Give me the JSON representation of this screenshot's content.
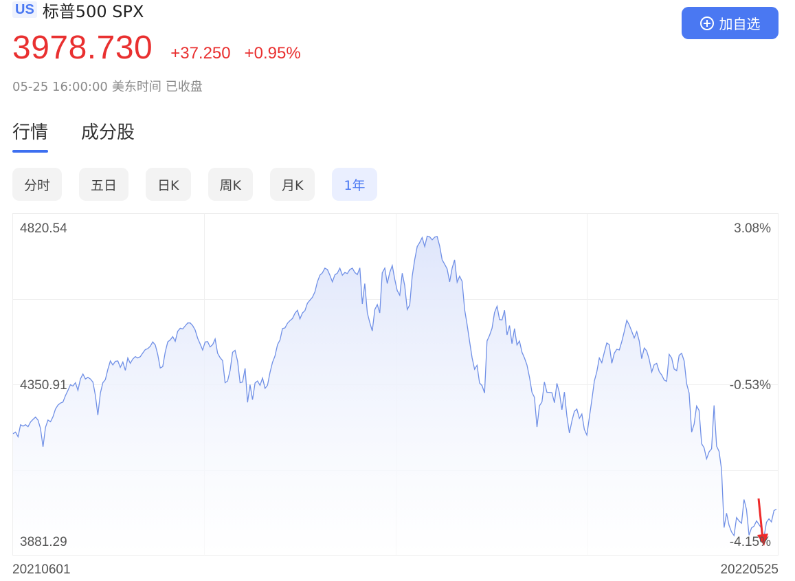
{
  "header": {
    "market": "US",
    "name": "标普500 SPX"
  },
  "quote": {
    "price": "3978.730",
    "change": "+37.250",
    "change_pct": "+0.95%",
    "date_time": "05-25 16:00:00",
    "timezone": "美东时间",
    "status": "已收盘"
  },
  "watchlist_button": {
    "label": "加自选",
    "icon": "plus-circle-icon"
  },
  "tabs": [
    {
      "label": "行情",
      "active": true
    },
    {
      "label": "成分股",
      "active": false
    }
  ],
  "periods": [
    {
      "label": "分时",
      "active": false
    },
    {
      "label": "五日",
      "active": false
    },
    {
      "label": "日K",
      "active": false
    },
    {
      "label": "周K",
      "active": false
    },
    {
      "label": "月K",
      "active": false
    },
    {
      "label": "1年",
      "active": true
    }
  ],
  "colors": {
    "up": "#e93030",
    "accent": "#4a78f2",
    "line": "#6f8fe6",
    "fill_top": "#dfe6fb",
    "arrow": "#ee2a2a"
  },
  "chart_data": {
    "type": "area",
    "title": "",
    "x_start_label": "20210601",
    "x_end_label": "20220525",
    "ylim": [
      3881.29,
      4820.54
    ],
    "y_tick_labels": [
      "4820.54",
      "4350.91",
      "3881.29"
    ],
    "y_right_labels": [
      "3.08%",
      "-0.53%",
      "-4.15%"
    ],
    "grid": true,
    "values": [
      4205,
      4210,
      4196,
      4232,
      4228,
      4232,
      4226,
      4240,
      4248,
      4255,
      4246,
      4221,
      4166,
      4224,
      4246,
      4241,
      4256,
      4279,
      4291,
      4297,
      4300,
      4319,
      4335,
      4352,
      4348,
      4358,
      4335,
      4369,
      4384,
      4369,
      4374,
      4369,
      4360,
      4320,
      4261,
      4327,
      4358,
      4367,
      4398,
      4423,
      4411,
      4422,
      4423,
      4404,
      4420,
      4395,
      4432,
      4416,
      4429,
      4436,
      4432,
      4436,
      4447,
      4457,
      4460,
      4467,
      4480,
      4471,
      4442,
      4402,
      4406,
      4450,
      4480,
      4486,
      4496,
      4482,
      4512,
      4521,
      4519,
      4528,
      4537,
      4537,
      4529,
      4516,
      4491,
      4474,
      4456,
      4480,
      4481,
      4465,
      4472,
      4489,
      4446,
      4433,
      4424,
      4358,
      4363,
      4395,
      4449,
      4455,
      4422,
      4358,
      4360,
      4401,
      4299,
      4352,
      4307,
      4357,
      4363,
      4350,
      4372,
      4341,
      4350,
      4389,
      4419,
      4438,
      4472,
      4486,
      4520,
      4522,
      4536,
      4544,
      4550,
      4566,
      4575,
      4549,
      4567,
      4574,
      4596,
      4605,
      4614,
      4630,
      4660,
      4680,
      4687,
      4701,
      4697,
      4680,
      4660,
      4681,
      4686,
      4701,
      4680,
      4688,
      4685,
      4697,
      4701,
      4688,
      4682,
      4702,
      4594,
      4655,
      4567,
      4538,
      4513,
      4577,
      4592,
      4567,
      4687,
      4701,
      4655,
      4688,
      4709,
      4668,
      4634,
      4620,
      4686,
      4649,
      4577,
      4591,
      4677,
      4726,
      4766,
      4778,
      4793,
      4766,
      4797,
      4795,
      4786,
      4794,
      4796,
      4767,
      4726,
      4713,
      4699,
      4660,
      4701,
      4726,
      4659,
      4677,
      4662,
      4577,
      4532,
      4482,
      4432,
      4398,
      4410,
      4357,
      4349,
      4327,
      4483,
      4500,
      4521,
      4568,
      4587,
      4547,
      4546,
      4575,
      4501,
      4529,
      4475,
      4520,
      4471,
      4483,
      4449,
      4432,
      4411,
      4374,
      4329,
      4314,
      4225,
      4289,
      4300,
      4360,
      4329,
      4329,
      4328,
      4298,
      4356,
      4328,
      4277,
      4330,
      4258,
      4207,
      4243,
      4272,
      4279,
      4251,
      4264,
      4218,
      4201,
      4254,
      4306,
      4363,
      4391,
      4432,
      4418,
      4449,
      4477,
      4472,
      4416,
      4446,
      4458,
      4456,
      4481,
      4511,
      4545,
      4531,
      4512,
      4492,
      4511,
      4483,
      4430,
      4462,
      4453,
      4428,
      4390,
      4412,
      4416,
      4391,
      4381,
      4366,
      4362,
      4443,
      4432,
      4399,
      4394,
      4440,
      4446,
      4423,
      4355,
      4327,
      4210,
      4234,
      4288,
      4275,
      4175,
      4163,
      4130,
      4151,
      4160,
      4290,
      4168,
      4152,
      4098,
      3924,
      3967,
      3931,
      3911,
      3900,
      3954,
      3944,
      3937,
      4008,
      3978,
      3901,
      3923,
      3928,
      3944,
      3933,
      3922,
      3895,
      3940,
      3950,
      3941,
      3975,
      3979
    ]
  }
}
